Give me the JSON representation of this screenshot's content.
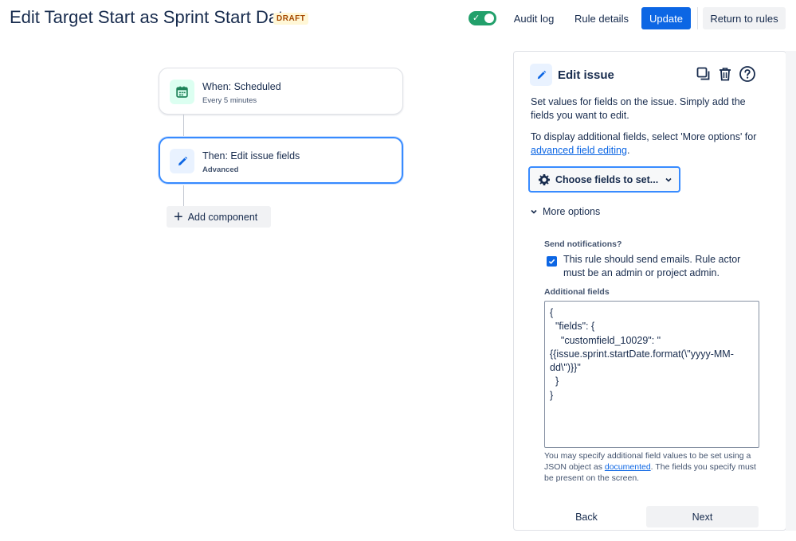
{
  "header": {
    "title": "Edit Target Start as Sprint Start Date",
    "badge": "DRAFT",
    "toggle_check": "✓",
    "audit_log": "Audit log",
    "rule_details": "Rule details",
    "update": "Update",
    "return_to_rules": "Return to rules"
  },
  "flow": {
    "trigger": {
      "title": "When: Scheduled",
      "subtitle": "Every 5 minutes",
      "icon": "calendar-icon"
    },
    "action": {
      "title": "Then: Edit issue fields",
      "subtitle": "Advanced",
      "icon": "pencil-icon"
    },
    "add_component": "Add component"
  },
  "panel": {
    "title": "Edit issue",
    "description": "Set values for fields on the issue. Simply add the fields you want to edit.",
    "more_fields_prefix": "To display additional fields, select 'More options' for ",
    "more_fields_link": "advanced field editing",
    "more_fields_suffix": ".",
    "choose_fields": "Choose fields to set...",
    "more_options": "More options",
    "send_notifications_label": "Send notifications?",
    "send_notifications_text": "This rule should send emails. Rule actor must be an admin or project admin.",
    "send_notifications_checked": true,
    "additional_fields_label": "Additional fields",
    "additional_fields_value": "{\n  \"fields\": {\n    \"customfield_10029\": \"{{issue.sprint.startDate.format(\\\"yyyy-MM-dd\\\")}}\"\n  }\n}",
    "help_prefix": "You may specify additional field values to be set using a JSON object as ",
    "help_link": "documented",
    "help_suffix": ". The fields you specify must be present on the screen.",
    "back": "Back",
    "next": "Next"
  },
  "colors": {
    "primary": "#0c66e4",
    "toggle_on": "#22a06b",
    "selected_border": "#388bff",
    "trigger_icon_bg": "#dcfff1",
    "trigger_icon": "#1f845a",
    "action_icon_bg": "#e9f2ff"
  }
}
